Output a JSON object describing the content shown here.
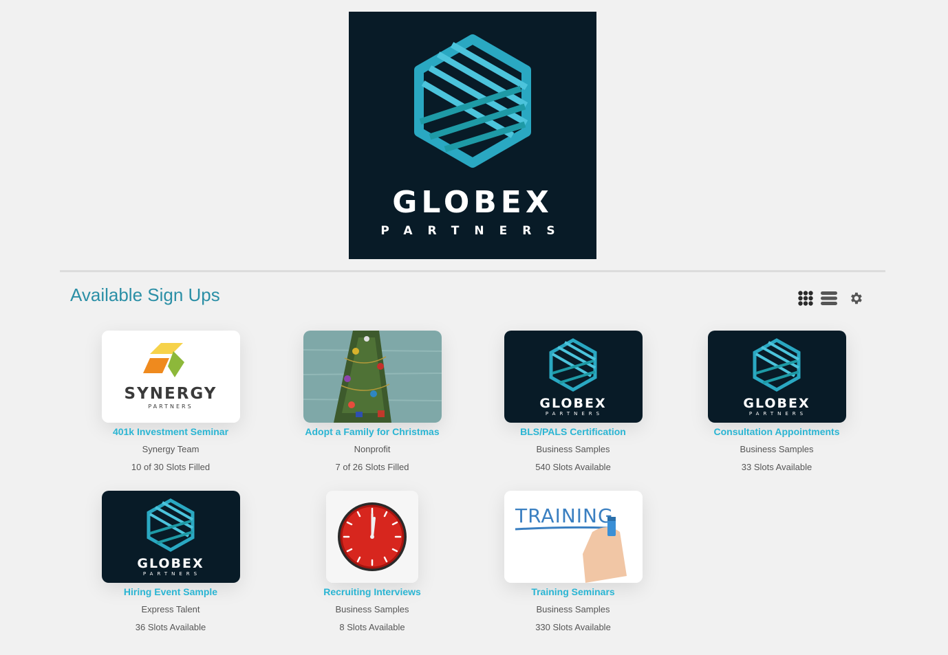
{
  "hero": {
    "brand_name": "GLOBEX",
    "brand_sub": "PARTNERS"
  },
  "page": {
    "title": "Available Sign Ups"
  },
  "toolbar": {
    "grid_view_icon": "grid-icon",
    "list_view_icon": "list-icon",
    "settings_icon": "gear-icon"
  },
  "colors": {
    "accent": "#2ab5d3",
    "title": "#2b8fa6",
    "brand_dark": "#081b27",
    "brand_teal": "#1fa6b8",
    "text_muted": "#555555"
  },
  "cards": [
    {
      "title": "401k Investment Seminar",
      "org": "Synergy Team",
      "slots": "10 of 30 Slots Filled",
      "logo_text": "SYNERGY",
      "logo_sub": "PARTNERS"
    },
    {
      "title": "Adopt a Family for Christmas",
      "org": "Nonprofit",
      "slots": "7 of 26 Slots Filled"
    },
    {
      "title": "BLS/PALS Certification",
      "org": "Business Samples",
      "slots": "540 Slots Available",
      "logo_text": "GLOBEX",
      "logo_sub": "PARTNERS"
    },
    {
      "title": "Consultation Appointments",
      "org": "Business Samples",
      "slots": "33 Slots Available",
      "logo_text": "GLOBEX",
      "logo_sub": "PARTNERS"
    },
    {
      "title": "Hiring Event Sample",
      "org": "Express Talent",
      "slots": "36 Slots Available",
      "logo_text": "GLOBEX",
      "logo_sub": "PARTNERS"
    },
    {
      "title": "Recruiting Interviews",
      "org": "Business Samples",
      "slots": "8 Slots Available"
    },
    {
      "title": "Training Seminars",
      "org": "Business Samples",
      "slots": "330 Slots Available",
      "logo_text": "TRAINING"
    }
  ]
}
